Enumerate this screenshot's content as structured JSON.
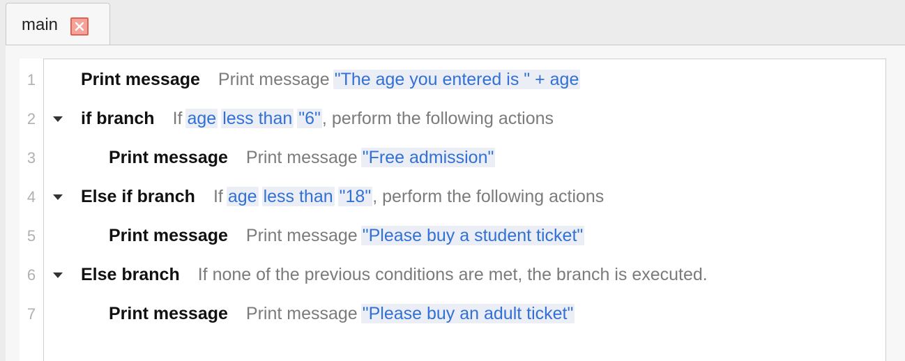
{
  "tab": {
    "label": "main",
    "close_icon": "close-icon"
  },
  "lines": [
    {
      "num": "1",
      "keyword": "Print message",
      "text": "Print message",
      "value": "\"The age you entered is \" + age"
    },
    {
      "num": "2",
      "keyword": "if branch",
      "if": "If",
      "var": "age",
      "op": "less than",
      "value": "\"6\"",
      "tail": ", perform the following actions"
    },
    {
      "num": "3",
      "keyword": "Print message",
      "text": "Print message",
      "value": "\"Free admission\""
    },
    {
      "num": "4",
      "keyword": "Else if branch",
      "if": "If",
      "var": "age",
      "op": "less than",
      "value": "\"18\"",
      "tail": ", perform the following actions"
    },
    {
      "num": "5",
      "keyword": "Print message",
      "text": "Print message",
      "value": "\"Please buy a student ticket\""
    },
    {
      "num": "6",
      "keyword": "Else branch",
      "text": "If none of the previous conditions are met, the branch is executed."
    },
    {
      "num": "7",
      "keyword": "Print message",
      "text": "Print message",
      "value": "\"Please buy an adult ticket\""
    }
  ],
  "colors": {
    "value_text": "#3370d6",
    "value_bg": "#ebeff5",
    "keyword": "#111111",
    "plain": "#7b7b7b",
    "tab_close": "#e06352"
  }
}
